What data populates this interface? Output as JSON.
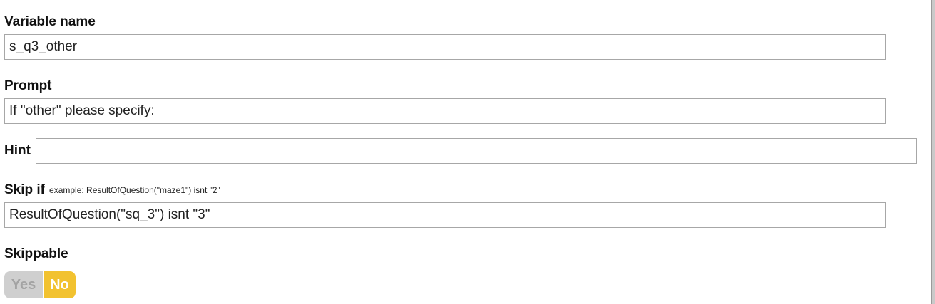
{
  "form": {
    "variable_name": {
      "label": "Variable name",
      "value": "s_q3_other"
    },
    "prompt": {
      "label": "Prompt",
      "value": "If \"other\" please specify:"
    },
    "hint": {
      "label": "Hint",
      "value": ""
    },
    "skip_if": {
      "label": "Skip if",
      "example": "example: ResultOfQuestion(\"maze1\") isnt \"2\"",
      "value": "ResultOfQuestion(\"sq_3\") isnt \"3\""
    },
    "skippable": {
      "label": "Skippable",
      "options": [
        "Yes",
        "No"
      ],
      "selected": "No"
    }
  },
  "colors": {
    "toggle_selected": "#f2c230",
    "toggle_unselected": "#cfcfcf",
    "field_border": "#a7a7a7"
  }
}
